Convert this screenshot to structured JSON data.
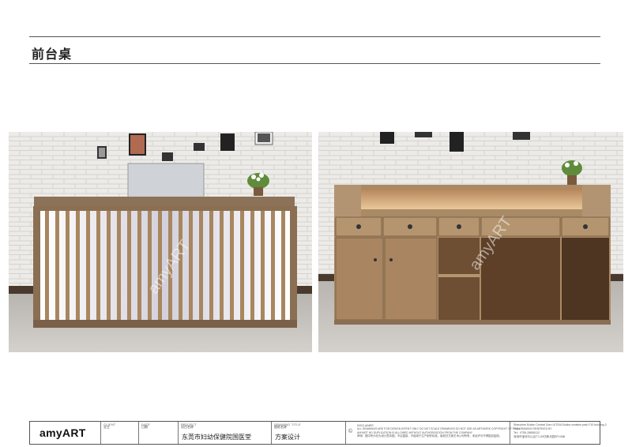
{
  "page": {
    "title": "前台桌"
  },
  "photos": {
    "watermark": "amyART"
  },
  "titleblock": {
    "logo": "amyART",
    "client_label": "CLIENT",
    "client_sub": "业主",
    "date_label": "DATE",
    "date_sub": "日期",
    "project_label": "PROJECT",
    "project_sub": "项目名称",
    "project_value": "东莞市妇幼保健院国医堂",
    "drawing_label": "DRAWING TITLE",
    "drawing_sub": "图纸名称",
    "drawing_value": "方案设计",
    "disclaimer_label": "DISCLAIMER",
    "disclaimer_en": "ALL DRAWINGS ARE FOR DESIGN INTENT ONLY DO NOT SCALE DRAWINGS DO NOT USE AS ARTWORK COPYRIGHT OF THIS DRAWING RESERVED BY AMYART NO DUPLICATION IS ALLOWED WITHOUT AUTHORIZATION FROM THE COMPANY",
    "disclaimer_cn": "声明：图中所示仅为设计意向图，不应直接，不能用于生产制作标准，版权归艾美艺术公司所有，未经许可不得擅自复制。",
    "company_en": "Shenzhen Bution Central Dom UIT516 Bution creative park F10 building 3 Floor",
    "company_tel": "Tel：0755-28658112",
    "company_cn": "深圳市宝安中心区T1-09坊和光园3F106B"
  }
}
